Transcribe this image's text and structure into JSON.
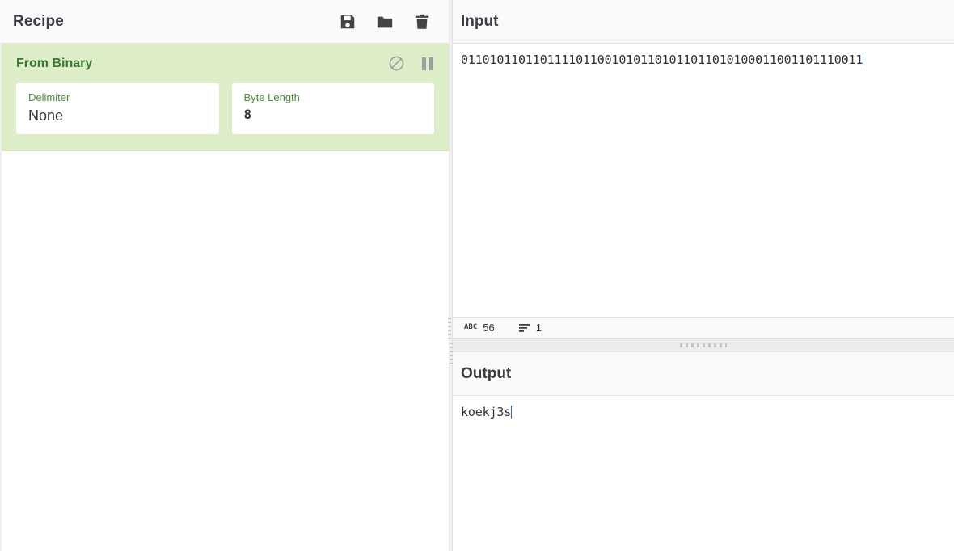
{
  "recipe": {
    "title": "Recipe",
    "actions": [
      {
        "name": "save-recipe-button",
        "icon": "save-icon",
        "label": "Save recipe"
      },
      {
        "name": "load-recipe-button",
        "icon": "folder-icon",
        "label": "Load recipe"
      },
      {
        "name": "clear-recipe-button",
        "icon": "trash-icon",
        "label": "Clear recipe"
      }
    ],
    "operations": [
      {
        "title": "From Binary",
        "disable_icon": "circle-slash-icon",
        "breakpoint_icon": "pause-icon",
        "args": [
          {
            "label": "Delimiter",
            "value": "None",
            "type": "select"
          },
          {
            "label": "Byte Length",
            "value": "8",
            "type": "number"
          }
        ]
      }
    ]
  },
  "input": {
    "title": "Input",
    "value": "01101011011011110110010101101011011010100011001101110011",
    "status": {
      "length_icon": "abc-icon",
      "length_icon_text": "ABC",
      "length": "56",
      "lines_icon": "lines-icon",
      "lines": "1"
    }
  },
  "output": {
    "title": "Output",
    "value": "koekj3s"
  },
  "colors": {
    "operation_bg": "#dcedc8",
    "operation_title": "#3a7a34",
    "arg_label": "#4b8b3b",
    "panel_header_bg": "#fafafa",
    "text": "#3c3c44"
  }
}
